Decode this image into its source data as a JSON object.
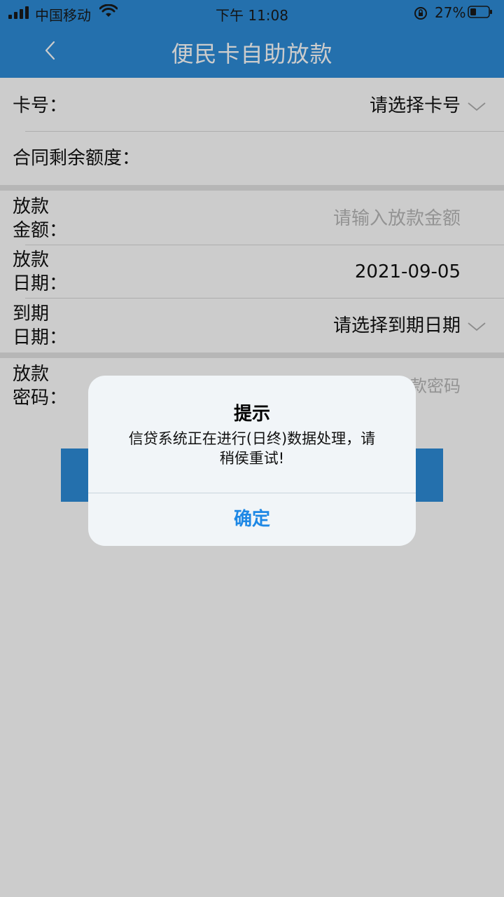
{
  "status_bar": {
    "carrier": "中国移动",
    "time": "下午 11:08",
    "battery": "27%"
  },
  "nav": {
    "title": "便民卡自助放款"
  },
  "form": {
    "card_label": "卡号：",
    "card_value": "请选择卡号",
    "contract_label": "合同剩余额度：",
    "amount_label_1": "放款",
    "amount_label_2": "金额：",
    "amount_placeholder": "请输入放款金额",
    "loan_date_label_1": "放款",
    "loan_date_label_2": "日期：",
    "loan_date_value": "2021-09-05",
    "due_date_label_1": "到期",
    "due_date_label_2": "日期：",
    "due_date_value": "请选择到期日期",
    "password_label_1": "放款",
    "password_label_2": "密码：",
    "password_placeholder_visible": "款密码"
  },
  "alert": {
    "title": "提示",
    "message_line1": "信贷系统正在进行(日终)数据处理，请",
    "message_line2": "稍侯重试!",
    "confirm": "确定"
  }
}
